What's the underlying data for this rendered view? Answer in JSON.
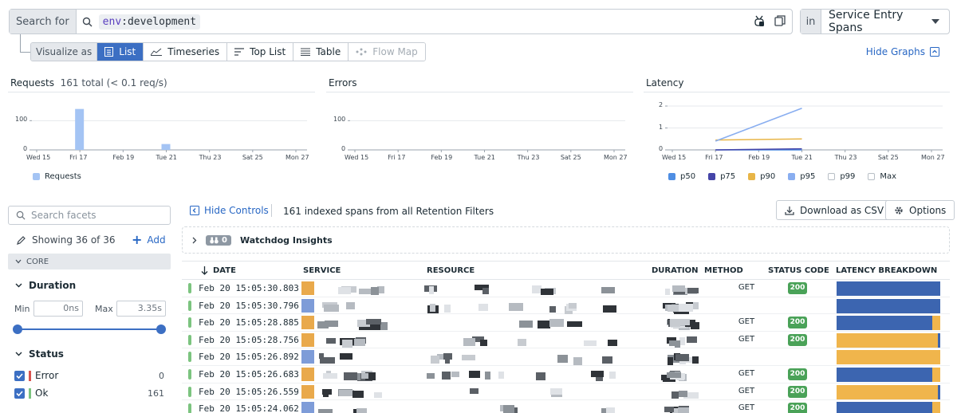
{
  "search": {
    "label": "Search for",
    "query_key": "env",
    "query_value": ":development",
    "in_label": "in",
    "scope": "Service Entry Spans"
  },
  "visualize": {
    "label": "Visualize as",
    "options": [
      "List",
      "Timeseries",
      "Top List",
      "Table",
      "Flow Map"
    ],
    "active": "List",
    "hide_graphs": "Hide Graphs"
  },
  "graphs": {
    "requests": {
      "title": "Requests",
      "subtitle": "161 total (< 0.1 req/s)",
      "legend": "Requests",
      "legend_color": "#a4c4f4"
    },
    "errors": {
      "title": "Errors"
    },
    "latency": {
      "title": "Latency",
      "legend": [
        {
          "name": "p50",
          "color": "#4f8ee3"
        },
        {
          "name": "p75",
          "color": "#4545a8"
        },
        {
          "name": "p90",
          "color": "#e8b547"
        },
        {
          "name": "p95",
          "color": "#89aef0"
        },
        {
          "name": "p99",
          "color": "#ffffff"
        },
        {
          "name": "Max",
          "color": "#ffffff"
        }
      ]
    },
    "x_ticks": [
      "Wed 15",
      "Fri 17",
      "Feb 19",
      "Tue 21",
      "Thu 23",
      "Sat 25",
      "Mon 27"
    ],
    "y_ticks_counts": [
      "100",
      "0"
    ],
    "y_ticks_latency": [
      "2",
      "1",
      "0"
    ]
  },
  "chart_data": [
    {
      "type": "bar",
      "title": "Requests",
      "categories": [
        "Wed 15",
        "Fri 17",
        "Feb 19",
        "Tue 21",
        "Thu 23",
        "Sat 25",
        "Mon 27"
      ],
      "series": [
        {
          "name": "Requests",
          "points": [
            {
              "x": "Fri 17",
              "y": 140
            },
            {
              "x": "Tue 21",
              "y": 20
            }
          ]
        }
      ],
      "yticks": [
        0,
        100
      ],
      "ylim": [
        0,
        150
      ]
    },
    {
      "type": "bar",
      "title": "Errors",
      "categories": [
        "Wed 15",
        "Fri 17",
        "Feb 19",
        "Tue 21",
        "Thu 23",
        "Sat 25",
        "Mon 27"
      ],
      "series": [
        {
          "name": "Errors",
          "points": []
        }
      ],
      "yticks": [
        0,
        100
      ],
      "ylim": [
        0,
        150
      ]
    },
    {
      "type": "line",
      "title": "Latency",
      "x": [
        "Fri 17",
        "Tue 21"
      ],
      "series": [
        {
          "name": "p50",
          "values": [
            0.0,
            0.0
          ]
        },
        {
          "name": "p75",
          "values": [
            0.0,
            0.05
          ]
        },
        {
          "name": "p90",
          "values": [
            0.45,
            0.5
          ]
        },
        {
          "name": "p95",
          "values": [
            0.4,
            1.9
          ]
        }
      ],
      "yticks": [
        0,
        1,
        2
      ],
      "ylim": [
        0,
        2
      ]
    }
  ],
  "facets": {
    "search_placeholder": "Search facets",
    "showing": "Showing 36 of 36",
    "add": "Add",
    "core": "CORE",
    "duration": {
      "title": "Duration",
      "min_label": "Min",
      "min_value": "0ns",
      "max_label": "Max",
      "max_value": "3.35s"
    },
    "status": {
      "title": "Status",
      "items": [
        {
          "label": "Error",
          "count": "0",
          "color": "#d9534f"
        },
        {
          "label": "Ok",
          "count": "161",
          "color": "#7cc47f"
        }
      ]
    }
  },
  "controls": {
    "hide_controls": "Hide Controls",
    "indexed": "161 indexed spans from all Retention Filters",
    "download": "Download as CSV",
    "options": "Options"
  },
  "watchdog": {
    "count": "0",
    "title": "Watchdog Insights"
  },
  "table": {
    "headers": [
      "DATE",
      "SERVICE",
      "RESOURCE",
      "DURATION",
      "METHOD",
      "STATUS CODE",
      "LATENCY BREAKDOWN"
    ],
    "rows": [
      {
        "date": "Feb 20 15:05:30.803",
        "method": "GET",
        "code": "200",
        "lat_blue": 1.0,
        "lat_orange": 0.0
      },
      {
        "date": "Feb 20 15:05:30.796",
        "method": "",
        "code": "",
        "lat_blue": 1.0,
        "lat_orange": 0.0
      },
      {
        "date": "Feb 20 15:05:28.885",
        "method": "GET",
        "code": "200",
        "lat_blue": 0.92,
        "lat_orange": 0.08
      },
      {
        "date": "Feb 20 15:05:28.756",
        "method": "GET",
        "code": "200",
        "lat_blue": 0.0,
        "lat_orange": 0.98
      },
      {
        "date": "Feb 20 15:05:26.892",
        "method": "",
        "code": "",
        "lat_blue": 0.0,
        "lat_orange": 1.0
      },
      {
        "date": "Feb 20 15:05:26.683",
        "method": "GET",
        "code": "200",
        "lat_blue": 0.92,
        "lat_orange": 0.08
      },
      {
        "date": "Feb 20 15:05:26.559",
        "method": "GET",
        "code": "200",
        "lat_blue": 0.0,
        "lat_orange": 0.98
      },
      {
        "date": "Feb 20 15:05:24.062",
        "method": "GET",
        "code": "200",
        "lat_blue": 0.92,
        "lat_orange": 0.08
      }
    ]
  }
}
